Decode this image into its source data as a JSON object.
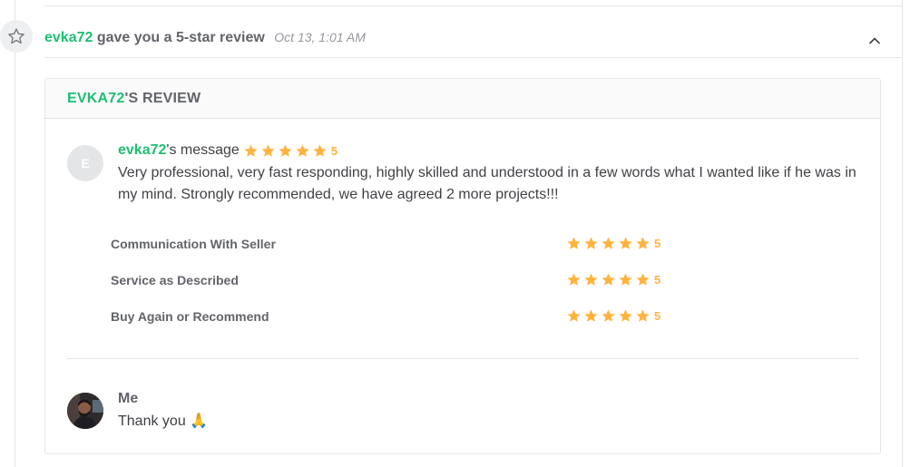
{
  "activity": {
    "user": "evka72",
    "action": "gave you a 5-star review",
    "timestamp": "Oct 13, 1:01 AM",
    "icon": "star-outline-icon",
    "collapse_icon": "chevron-up-icon"
  },
  "review_card": {
    "header_user": "EVKA72",
    "header_suffix": "'S REVIEW",
    "avatar_initial": "E",
    "message_user": "evka72",
    "message_suffix": "'s message",
    "overall_rating": "5",
    "message": "Very professional, very fast responding, highly skilled and understood in a few words what I wanted like if he was in my mind. Strongly recommended, we have agreed 2 more projects!!!",
    "ratings": [
      {
        "label": "Communication With Seller",
        "value": "5"
      },
      {
        "label": "Service as Described",
        "value": "5"
      },
      {
        "label": "Buy Again or Recommend",
        "value": "5"
      }
    ]
  },
  "reply": {
    "name": "Me",
    "text": "Thank you 🙏"
  },
  "colors": {
    "accent": "#1dbf73",
    "star": "#ffb33e",
    "text": "#404145",
    "muted": "#62646a",
    "border": "#e4e5e7"
  }
}
